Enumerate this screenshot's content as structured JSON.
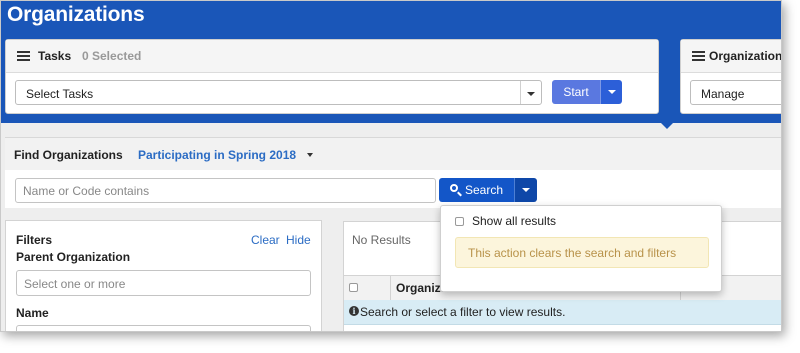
{
  "header": {
    "title": "Organizations"
  },
  "tasks_panel": {
    "title": "Tasks",
    "selected_count": "0 Selected",
    "select_value": "Select Tasks",
    "start_label": "Start"
  },
  "org_panel": {
    "title": "Organization",
    "select_value": "Manage"
  },
  "find": {
    "label": "Find Organizations",
    "filter_link": "Participating in Spring 2018",
    "search_placeholder": "Name or Code contains",
    "search_label": "Search"
  },
  "search_menu": {
    "show_all_label": "Show all results",
    "warning_text": "This action clears the search and filters"
  },
  "filters": {
    "title": "Filters",
    "clear_label": "Clear",
    "hide_label": "Hide",
    "parent_label": "Parent Organization",
    "parent_placeholder": "Select one or more",
    "name_label": "Name"
  },
  "results": {
    "status": "No Results",
    "column_header": "Organization",
    "info_message": "Search or select a filter to view results."
  },
  "colors": {
    "brand_blue": "#1a56b8",
    "primary_button": "#1356c8",
    "link": "#2b6cc4"
  },
  "icons": [
    "list-icon",
    "caret-down-icon",
    "search-icon",
    "info-icon"
  ]
}
